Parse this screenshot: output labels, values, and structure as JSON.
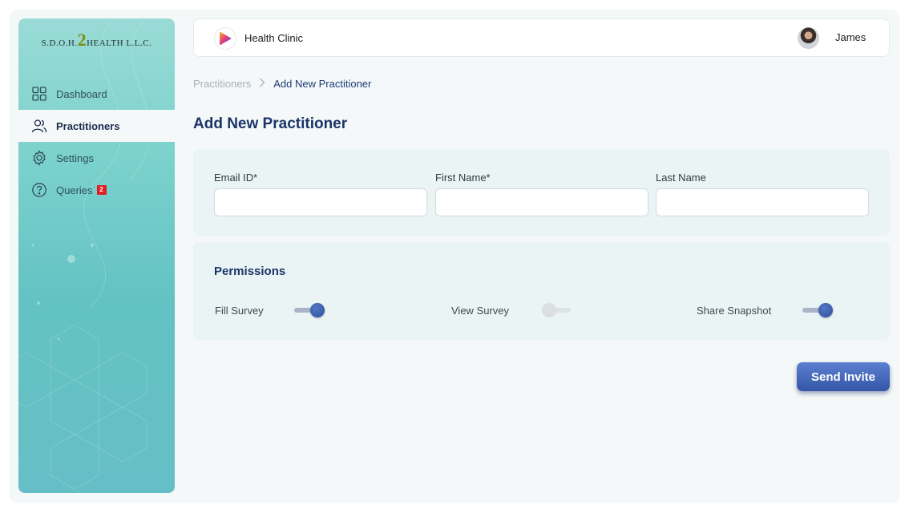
{
  "logo": {
    "prefix": "S.D.O.H.",
    "number": "2",
    "suffix": "HEALTH L.L.C."
  },
  "sidebar": {
    "items": [
      {
        "label": "Dashboard",
        "icon": "grid-icon",
        "active": false
      },
      {
        "label": "Practitioners",
        "icon": "users-icon",
        "active": true
      },
      {
        "label": "Settings",
        "icon": "gear-icon",
        "active": false
      },
      {
        "label": "Queries",
        "icon": "question-circle-icon",
        "active": false,
        "badge": "2"
      }
    ]
  },
  "header": {
    "title": "Health Clinic",
    "user_name": "James"
  },
  "breadcrumb": {
    "parent": "Practitioners",
    "separator": ">",
    "current": "Add New  Practitioner"
  },
  "page": {
    "title": "Add New Practitioner"
  },
  "form": {
    "email": {
      "label": "Email ID*",
      "value": "",
      "placeholder": ""
    },
    "first_name": {
      "label": "First Name*",
      "value": "",
      "placeholder": ""
    },
    "last_name": {
      "label": "Last Name",
      "value": "",
      "placeholder": ""
    }
  },
  "permissions": {
    "title": "Permissions",
    "items": [
      {
        "label": "Fill Survey",
        "enabled": true
      },
      {
        "label": "View Survey",
        "enabled": false
      },
      {
        "label": "Share Snapshot",
        "enabled": true
      }
    ]
  },
  "actions": {
    "send_label": "Send Invite"
  },
  "colors": {
    "accent": "#3556a6",
    "title": "#1a3469",
    "sidebar": "#6cc7c7",
    "badge": "#e21e25"
  }
}
